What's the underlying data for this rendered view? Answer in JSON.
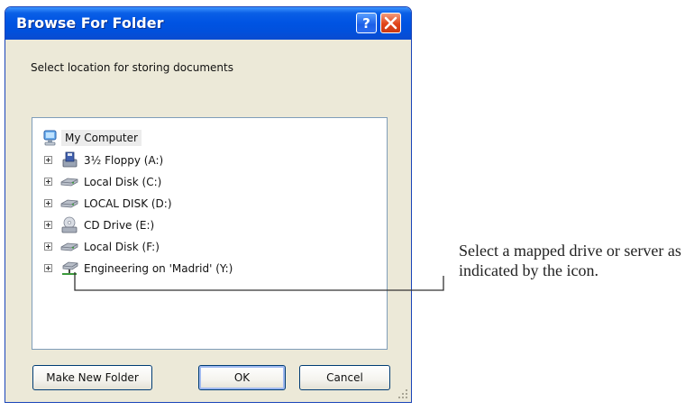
{
  "dialog": {
    "title": "Browse For Folder",
    "help_icon": "help-icon",
    "close_icon": "close-icon",
    "prompt": "Select location for storing documents",
    "tree": {
      "root": {
        "label": "My Computer",
        "icon": "my-computer-icon"
      },
      "items": [
        {
          "label": "3½ Floppy (A:)",
          "icon": "floppy-drive-icon"
        },
        {
          "label": "Local Disk (C:)",
          "icon": "hard-disk-icon"
        },
        {
          "label": "LOCAL DISK (D:)",
          "icon": "hard-disk-icon"
        },
        {
          "label": "CD Drive (E:)",
          "icon": "cd-drive-icon"
        },
        {
          "label": "Local Disk (F:)",
          "icon": "hard-disk-icon"
        },
        {
          "label": "Engineering on 'Madrid' (Y:)",
          "icon": "network-drive-icon"
        }
      ]
    },
    "buttons": {
      "make_new_folder": "Make New Folder",
      "ok": "OK",
      "cancel": "Cancel"
    }
  },
  "annotation": {
    "text": "Select a mapped drive or server as indicated by the icon."
  },
  "colors": {
    "title_bar": "#0054e3",
    "dialog_face": "#ece9d8",
    "close_button": "#e0441a"
  }
}
